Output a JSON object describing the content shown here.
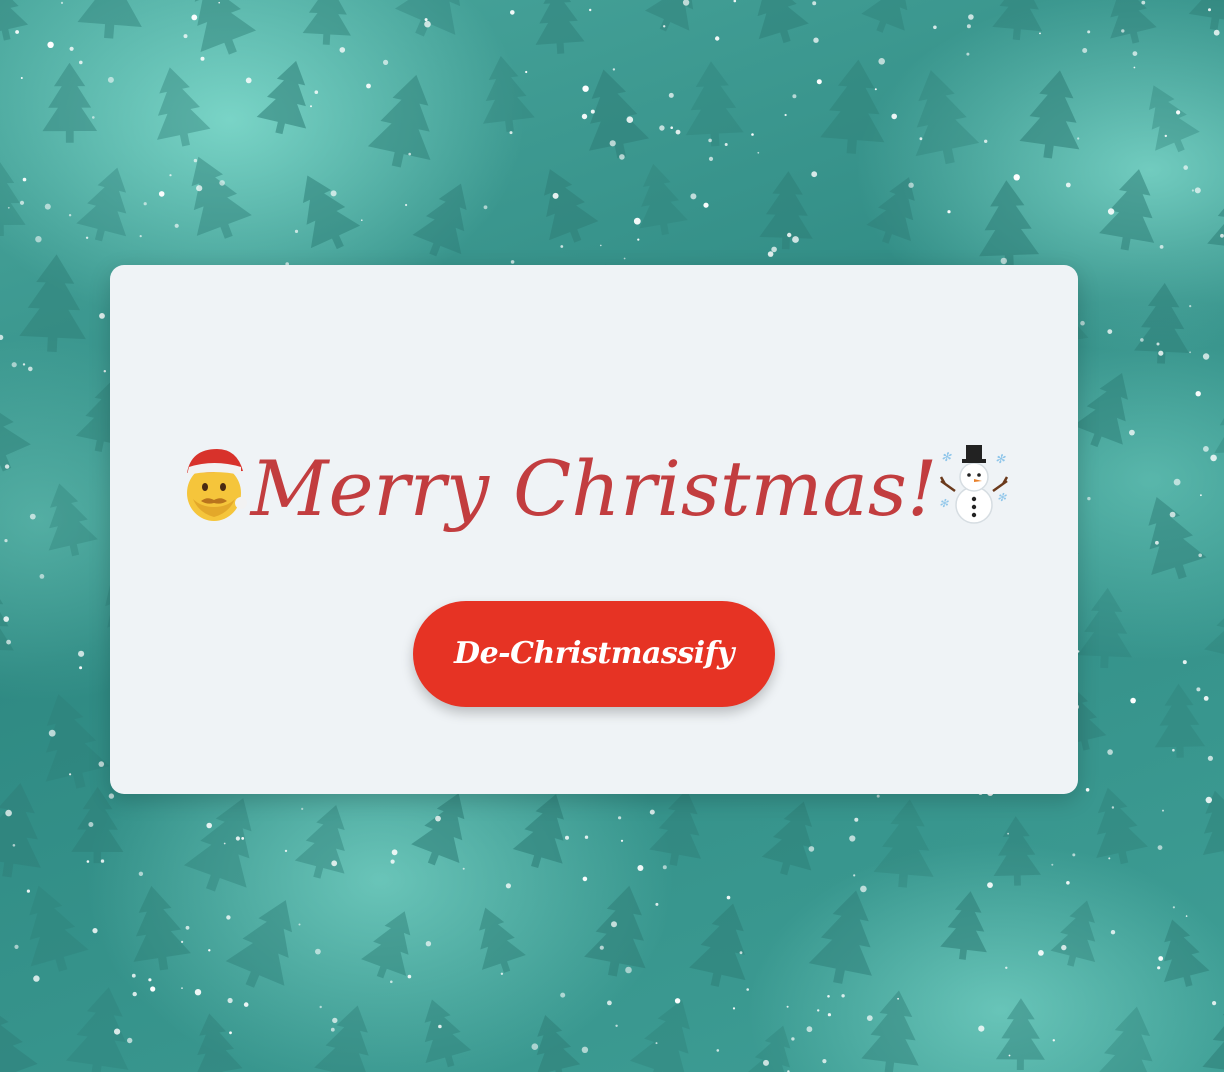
{
  "background": {
    "pattern": "christmas-trees-and-snow",
    "colors": {
      "base": "#3f9c94",
      "light": "#8ce6d7",
      "tree": "#2f7f78",
      "snow": "#ffffff"
    }
  },
  "card": {
    "title_prefix_icon": "santa-claus-emoji",
    "title": "Merry Christmas!",
    "title_suffix_icon": "snowman-emoji",
    "title_color": "#c23d3f"
  },
  "button": {
    "label": "De-Christmassify",
    "color": "#e63324"
  }
}
